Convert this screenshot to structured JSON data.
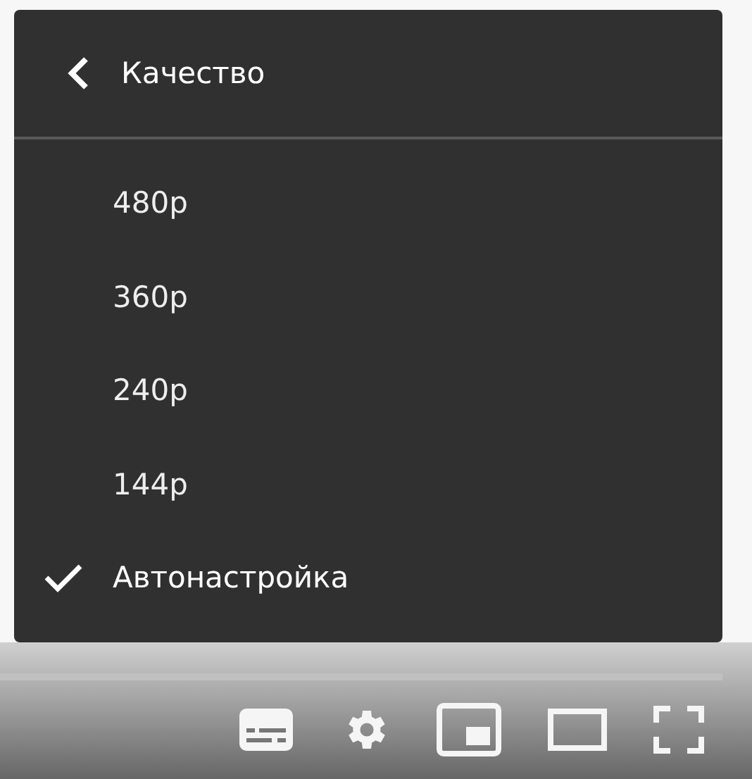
{
  "menu": {
    "title": "Качество",
    "items": [
      {
        "label": "480p",
        "selected": false
      },
      {
        "label": "360p",
        "selected": false
      },
      {
        "label": "240p",
        "selected": false
      },
      {
        "label": "144p",
        "selected": false
      },
      {
        "label": "Автонастройка",
        "selected": true
      }
    ]
  },
  "controls": [
    {
      "kind": "subtitles"
    },
    {
      "kind": "settings"
    },
    {
      "kind": "miniplayer"
    },
    {
      "kind": "theater"
    },
    {
      "kind": "fullscreen"
    }
  ]
}
